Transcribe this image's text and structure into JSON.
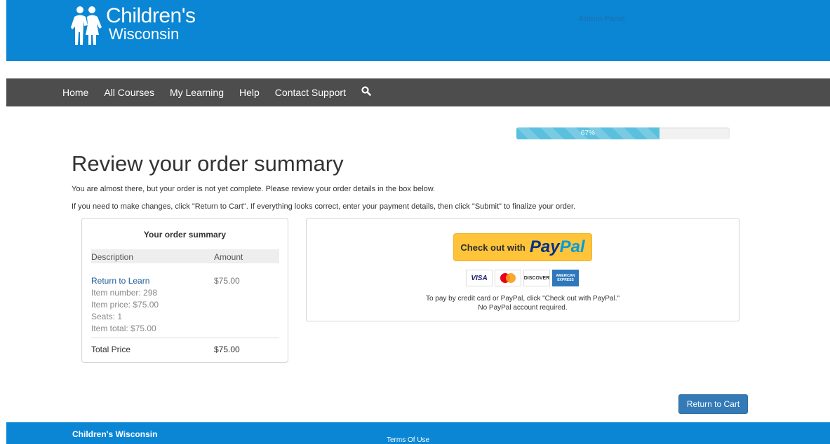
{
  "header": {
    "brand_line1": "Children's",
    "brand_line2": "Wisconsin",
    "admin_link": "Admin Panel"
  },
  "nav": {
    "items": [
      "Home",
      "All Courses",
      "My Learning",
      "Help",
      "Contact Support"
    ],
    "search_icon": "search-icon"
  },
  "progress": {
    "percent": 67,
    "label": "67%"
  },
  "page": {
    "title": "Review your order summary",
    "intro1": "You are almost there, but your order is not yet complete. Please review your order details in the box below.",
    "intro2": "If you need to make changes, click \"Return to Cart\". If everything looks correct, enter your payment details, then click \"Submit\" to finalize your order."
  },
  "summary": {
    "title": "Your order summary",
    "col_description": "Description",
    "col_amount": "Amount",
    "item": {
      "name": "Return to Learn",
      "amount": "$75.00",
      "details": [
        "Item number: 298",
        "Item price: $75.00",
        "Seats: 1",
        "Item total: $75.00"
      ]
    },
    "total_label": "Total Price",
    "total_amount": "$75.00"
  },
  "payment": {
    "button_text": "Check out with",
    "paypal_pay": "Pay",
    "paypal_pal": "Pal",
    "cards": [
      "VISA",
      "MasterCard",
      "DISCOVER",
      "AMERICAN EXPRESS"
    ],
    "note": "To pay by credit card or PayPal, click \"Check out with PayPal.\" No PayPal account required."
  },
  "actions": {
    "return_to_cart": "Return to Cart"
  },
  "footer": {
    "brand": "Children's Wisconsin",
    "terms": "Terms Of Use"
  },
  "colors": {
    "header_blue": "#0a86d4",
    "nav_gray": "#4d4d4d",
    "progress_fill": "#5bc0de",
    "button_blue": "#337ab7",
    "paypal_yellow": "#ffc439"
  }
}
